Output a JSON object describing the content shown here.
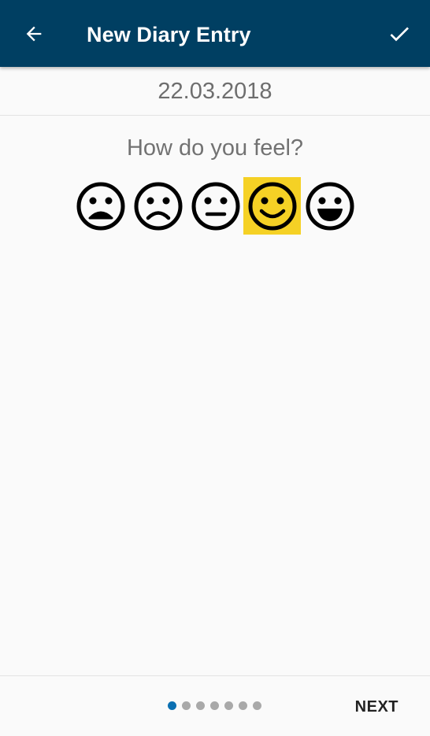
{
  "header": {
    "title": "New Diary Entry",
    "back_icon": "arrow-left-icon",
    "confirm_icon": "check-icon",
    "background_color": "#003f62"
  },
  "date": "22.03.2018",
  "mood_question": "How do you feel?",
  "moods": [
    {
      "name": "very-sad",
      "icon": "very-sad-face-icon",
      "selected": false
    },
    {
      "name": "sad",
      "icon": "sad-face-icon",
      "selected": false
    },
    {
      "name": "neutral",
      "icon": "neutral-face-icon",
      "selected": false
    },
    {
      "name": "happy",
      "icon": "smile-face-icon",
      "selected": true
    },
    {
      "name": "very-happy",
      "icon": "grin-face-icon",
      "selected": false
    }
  ],
  "selected_color": "#f5d125",
  "pager": {
    "total_pages": 7,
    "current_page": 1,
    "active_color": "#0b70b2",
    "inactive_color": "#a9a9a9"
  },
  "next_label": "NEXT"
}
